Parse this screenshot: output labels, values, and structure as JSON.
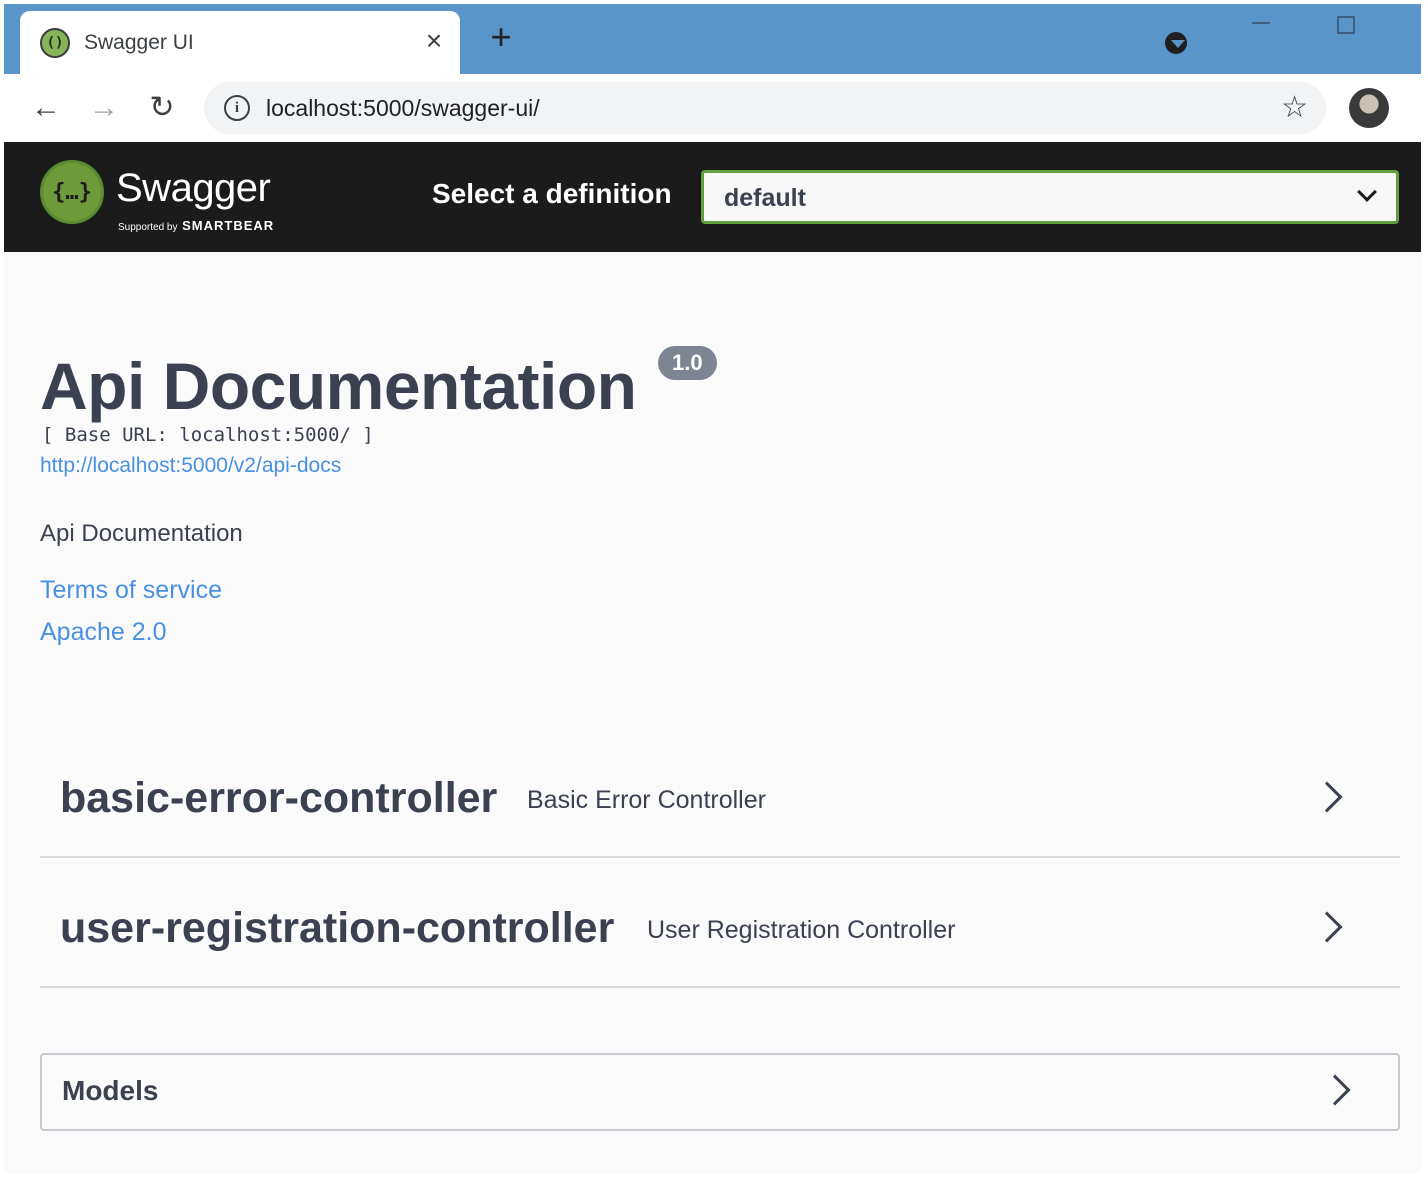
{
  "browser": {
    "tab_title": "Swagger UI",
    "tab_close": "×",
    "new_tab": "+",
    "url": "localhost:5000/swagger-ui/",
    "back": "←",
    "forward": "→",
    "reload": "↻",
    "info": "i",
    "star": "☆",
    "icons": {
      "favicon": "swagger-favicon-icon",
      "close": "close-icon",
      "new_tab": "plus-icon",
      "back": "arrow-left-icon",
      "forward": "arrow-right-icon",
      "reload": "reload-icon",
      "info": "info-icon",
      "star": "star-icon"
    }
  },
  "swagger": {
    "brand": "Swagger",
    "supported_by": "Supported by",
    "smartbear": "SMARTBEAR",
    "logo_glyph": "{…}",
    "definition_label": "Select a definition",
    "definition_value": "default",
    "accent_color": "#62a03f"
  },
  "info": {
    "title": "Api Documentation",
    "version": "1.0",
    "base_url": "[ Base URL: localhost:5000/ ]",
    "spec_url": "http://localhost:5000/v2/api-docs",
    "description": "Api Documentation",
    "terms": "Terms of service",
    "license": "Apache 2.0"
  },
  "tags": [
    {
      "name": "basic-error-controller",
      "description": "Basic Error Controller"
    },
    {
      "name": "user-registration-controller",
      "description": "User Registration Controller"
    }
  ],
  "models": {
    "title": "Models"
  }
}
